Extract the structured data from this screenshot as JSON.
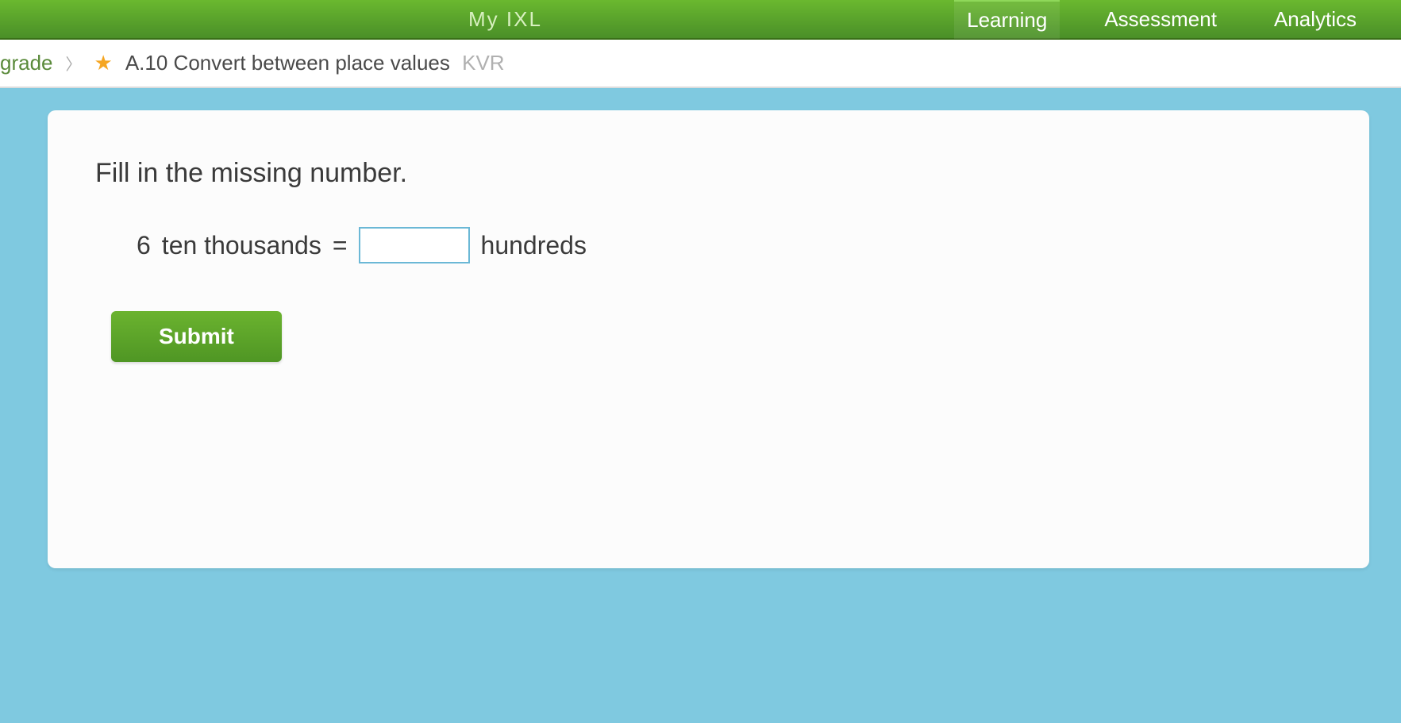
{
  "nav": {
    "brand": "My IXL",
    "items": [
      {
        "label": "Learning",
        "active": true
      },
      {
        "label": "Assessment",
        "active": false
      },
      {
        "label": "Analytics",
        "active": false
      }
    ]
  },
  "breadcrumb": {
    "grade_label": "grade",
    "skill_number": "A.10",
    "skill_title": "Convert between place values",
    "skill_code": "KVR"
  },
  "question": {
    "prompt": "Fill in the missing number.",
    "left_qty": "6",
    "left_unit": "ten thousands",
    "equals": "=",
    "right_unit": "hundreds",
    "answer_value": ""
  },
  "buttons": {
    "submit": "Submit"
  }
}
